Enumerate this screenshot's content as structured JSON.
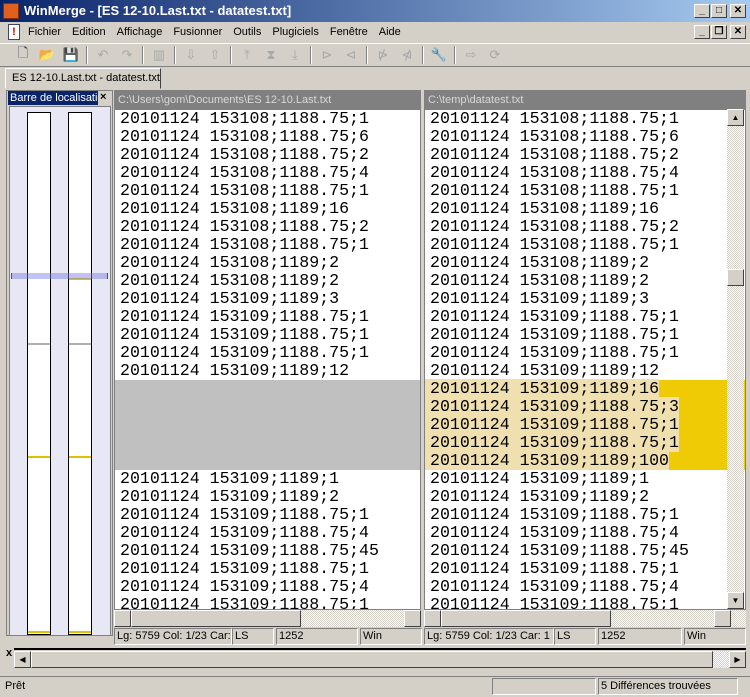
{
  "window": {
    "title": "WinMerge - [ES 12-10.Last.txt - datatest.txt]",
    "minimize": "_",
    "maximize": "□",
    "close": "✕",
    "child_restore": "🗗"
  },
  "menu": [
    "Fichier",
    "Edition",
    "Affichage",
    "Fusionner",
    "Outils",
    "Plugiciels",
    "Fenêtre",
    "Aide"
  ],
  "toolbar": [
    {
      "name": "new-icon",
      "glyph": "🗋",
      "on": true
    },
    {
      "name": "open-icon",
      "glyph": "📂",
      "on": true
    },
    {
      "name": "save-icon",
      "glyph": "💾",
      "on": true
    },
    {
      "sep": true
    },
    {
      "name": "undo-icon",
      "glyph": "↶"
    },
    {
      "name": "redo-icon",
      "glyph": "↷"
    },
    {
      "sep": true
    },
    {
      "name": "options-icon",
      "glyph": "▥"
    },
    {
      "sep": true
    },
    {
      "name": "next-diff-icon",
      "glyph": "⇩"
    },
    {
      "name": "prev-diff-icon",
      "glyph": "⇧"
    },
    {
      "sep": true
    },
    {
      "name": "first-diff-icon",
      "glyph": "⤒"
    },
    {
      "name": "current-diff-icon",
      "glyph": "⧗"
    },
    {
      "name": "last-diff-icon",
      "glyph": "⤓"
    },
    {
      "sep": true
    },
    {
      "name": "copy-right-icon",
      "glyph": "⊳"
    },
    {
      "name": "copy-left-icon",
      "glyph": "⊲"
    },
    {
      "sep": true
    },
    {
      "name": "copy-right-advance-icon",
      "glyph": "⋫"
    },
    {
      "name": "copy-left-advance-icon",
      "glyph": "⋪"
    },
    {
      "sep": true
    },
    {
      "name": "settings-icon",
      "glyph": "🔧",
      "on": true
    },
    {
      "sep": true
    },
    {
      "name": "merge-all-icon",
      "glyph": "⇨"
    },
    {
      "name": "refresh-icon",
      "glyph": "⟳"
    }
  ],
  "tab": "ES 12-10.Last.txt - datatest.txt",
  "location_bar": {
    "title": "Barre de localisation",
    "close": "×"
  },
  "left": {
    "path": "C:\\Users\\gom\\Documents\\ES 12-10.Last.txt",
    "lines": [
      "20101124 153108;1188.75;1",
      "20101124 153108;1188.75;6",
      "20101124 153108;1188.75;2",
      "20101124 153108;1188.75;4",
      "20101124 153108;1188.75;1",
      "20101124 153108;1189;16",
      "20101124 153108;1188.75;2",
      "20101124 153108;1188.75;1",
      "20101124 153108;1189;2",
      "20101124 153108;1189;2",
      "20101124 153109;1189;3",
      "20101124 153109;1188.75;1",
      "20101124 153109;1188.75;1",
      "20101124 153109;1188.75;1",
      "20101124 153109;1189;12",
      "",
      "",
      "",
      "",
      "",
      "20101124 153109;1189;1",
      "20101124 153109;1189;2",
      "20101124 153109;1188.75;1",
      "20101124 153109;1188.75;4",
      "20101124 153109;1188.75;45",
      "20101124 153109;1188.75;1",
      "20101124 153109;1188.75;4",
      "20101124 153109;1188.75;1"
    ],
    "status": {
      "pos": "Lg: 5759  Col: 1/23  Car: 1",
      "eol": "LS",
      "codepage": "1252",
      "type": "Win"
    }
  },
  "right": {
    "path": "C:\\temp\\datatest.txt",
    "lines": [
      "20101124 153108;1188.75;1",
      "20101124 153108;1188.75;6",
      "20101124 153108;1188.75;2",
      "20101124 153108;1188.75;4",
      "20101124 153108;1188.75;1",
      "20101124 153108;1189;16",
      "20101124 153108;1188.75;2",
      "20101124 153108;1188.75;1",
      "20101124 153108;1189;2",
      "20101124 153108;1189;2",
      "20101124 153109;1189;3",
      "20101124 153109;1188.75;1",
      "20101124 153109;1188.75;1",
      "20101124 153109;1188.75;1",
      "20101124 153109;1189;12",
      "20101124 153109;1189;16",
      "20101124 153109;1188.75;3",
      "20101124 153109;1188.75;1",
      "20101124 153109;1188.75;1",
      "20101124 153109;1189;100",
      "20101124 153109;1189;1",
      "20101124 153109;1189;2",
      "20101124 153109;1188.75;1",
      "20101124 153109;1188.75;4",
      "20101124 153109;1188.75;45",
      "20101124 153109;1188.75;1",
      "20101124 153109;1188.75;4",
      "20101124 153109;1188.75;1"
    ],
    "status": {
      "pos": "Lg: 5759  Col: 1/23  Car: 1",
      "eol": "LS",
      "codepage": "1252",
      "type": "Win"
    }
  },
  "diff_rows": [
    15,
    16,
    17,
    18,
    19
  ],
  "colors": {
    "diff_bg": "#efcb05",
    "diff_text_bg": "#f0e0b0",
    "blank_bg": "#c0c0c0"
  },
  "diff_pane": {
    "close": "x"
  },
  "statusbar": {
    "left": "Prêt",
    "right": "5 Différences trouvées"
  }
}
